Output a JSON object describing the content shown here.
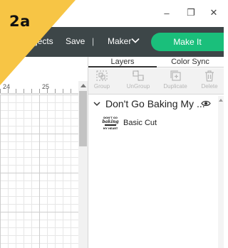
{
  "badge": {
    "label": "2a",
    "color": "#f7c545"
  },
  "window_controls": {
    "minimize": "–",
    "maximize": "❐",
    "close": "✕"
  },
  "toolbar": {
    "objects_label": "Objects",
    "save_label": "Save",
    "divider": "|",
    "machine_label": "Maker",
    "make_it_label": "Make It",
    "background_color": "#3d4648",
    "make_it_color": "#1abf7b"
  },
  "canvas": {
    "ruler_numbers": [
      "24",
      "25"
    ]
  },
  "panel": {
    "tabs": [
      {
        "label": "Layers",
        "active": true
      },
      {
        "label": "Color Sync",
        "active": false
      }
    ],
    "actions": [
      {
        "label": "Group",
        "icon": "group-icon"
      },
      {
        "label": "UnGroup",
        "icon": "ungroup-icon"
      },
      {
        "label": "Duplicate",
        "icon": "duplicate-icon"
      },
      {
        "label": "Delete",
        "icon": "delete-icon"
      }
    ],
    "layer_group": {
      "title": "Don't Go Baking My ...",
      "visible": true
    },
    "layers": [
      {
        "label": "Basic Cut",
        "thumbnail_text": [
          "DON'T GO",
          "baking",
          "MY HEART"
        ]
      }
    ]
  }
}
